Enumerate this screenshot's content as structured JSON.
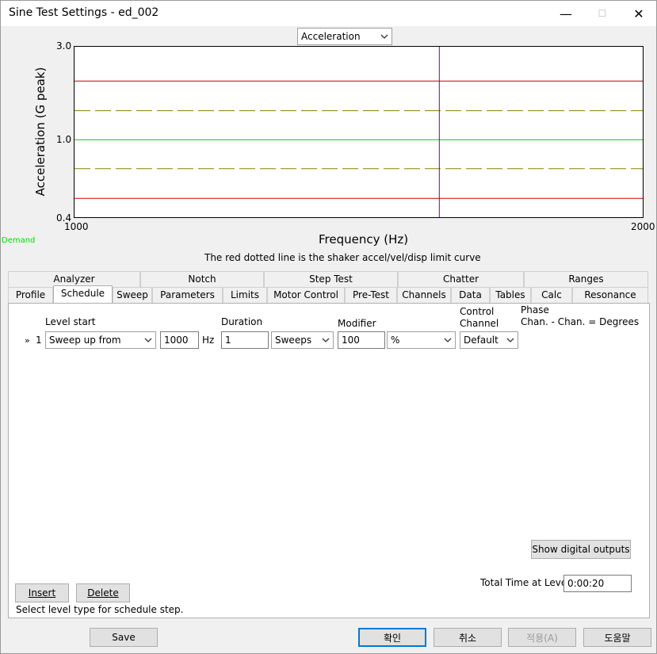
{
  "window": {
    "title": "Sine Test Settings - ed_002",
    "minimize_glyph": "—",
    "maximize_glyph": "☐",
    "close_glyph": "✕"
  },
  "chart": {
    "display_select": {
      "value": "Acceleration"
    },
    "ylabel": "Acceleration (G peak)",
    "xlabel": "Frequency (Hz)",
    "y_ticks": [
      "3.0",
      "1.0",
      "0.4"
    ],
    "x_ticks": [
      "1000",
      "2000"
    ],
    "demand_label": "Demand",
    "caption": "The red dotted line is the shaker accel/vel/disp limit curve",
    "colors": {
      "limit": "#cc0000",
      "abort_tolerance": "#808000",
      "demand": "#00cc00",
      "cursor": "#800080"
    }
  },
  "chart_data": {
    "type": "line",
    "xlabel": "Frequency (Hz)",
    "ylabel": "Acceleration (G peak)",
    "xlim": [
      1000,
      2000
    ],
    "ylim": [
      0.4,
      3.0
    ],
    "y_scale": "log",
    "series": [
      {
        "values": [
          2.0,
          2.0
        ],
        "x": [
          1000,
          2000
        ],
        "color": "#cc0000",
        "style": "solid"
      },
      {
        "values": [
          1.41,
          1.41
        ],
        "x": [
          1000,
          2000
        ],
        "color": "#808000",
        "style": "dashed"
      },
      {
        "name": "Demand",
        "values": [
          1.0,
          1.0
        ],
        "x": [
          1000,
          2000
        ],
        "color": "#00cc00",
        "style": "solid"
      },
      {
        "values": [
          0.71,
          0.71
        ],
        "x": [
          1000,
          2000
        ],
        "color": "#808000",
        "style": "dashed"
      },
      {
        "values": [
          0.5,
          0.5
        ],
        "x": [
          1000,
          2000
        ],
        "color": "#cc0000",
        "style": "solid"
      }
    ],
    "cursor_x": 1642
  },
  "tabs": {
    "row1": [
      "Analyzer",
      "Notch",
      "Step Test",
      "Chatter",
      "Ranges"
    ],
    "row2": [
      "Profile",
      "Schedule",
      "Sweep",
      "Parameters",
      "Limits",
      "Motor Control",
      "Pre-Test",
      "Channels",
      "Data",
      "Tables",
      "Calc",
      "Resonance"
    ],
    "selected": "Schedule"
  },
  "schedule": {
    "headers": {
      "level_start": "Level start",
      "duration": "Duration",
      "modifier": "Modifier",
      "control_channel_1": "Control",
      "control_channel_2": "Channel",
      "phase_1": "Phase",
      "phase_2": "Chan. - Chan. = Degrees"
    },
    "row": {
      "marker": "»",
      "index": "1",
      "level_type": "Sweep up from",
      "frequency": "1000",
      "frequency_unit": "Hz",
      "duration": "1",
      "duration_unit": "Sweeps",
      "modifier": "100",
      "modifier_unit": "%",
      "control_channel": "Default"
    },
    "show_digital_outputs": "Show digital outputs",
    "total_time_label": "Total Time at Level",
    "total_time_value": "0:00:20",
    "insert_label": "Insert",
    "delete_label": "Delete",
    "status_text": "Select level type for schedule step."
  },
  "footer": {
    "save": "Save",
    "ok": "확인",
    "cancel": "취소",
    "apply": "적용(A)",
    "help": "도움말"
  }
}
